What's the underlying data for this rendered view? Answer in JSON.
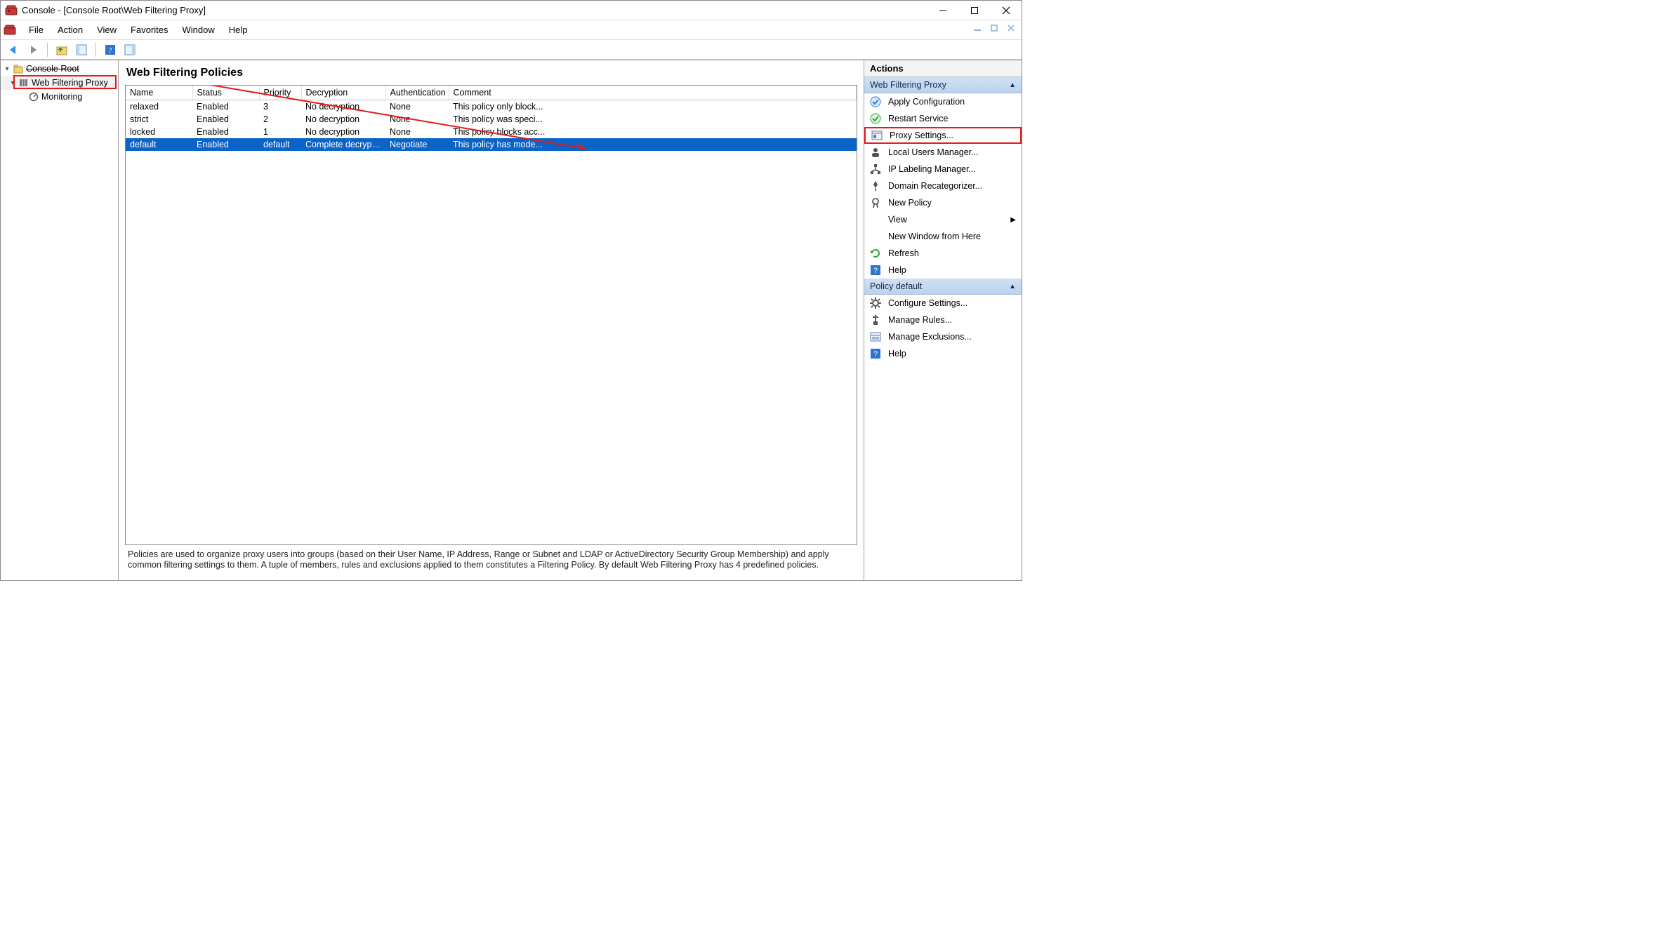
{
  "titlebar": {
    "title": "Console - [Console Root\\Web Filtering Proxy]"
  },
  "menubar": {
    "items": [
      "File",
      "Action",
      "View",
      "Favorites",
      "Window",
      "Help"
    ]
  },
  "tree": {
    "root_label": "Console Root",
    "proxy_label": "Web Filtering Proxy",
    "monitoring_label": "Monitoring"
  },
  "center": {
    "title": "Web Filtering Policies",
    "columns": [
      "Name",
      "Status",
      "Priority",
      "Decryption",
      "Authentication",
      "Comment"
    ],
    "rows": [
      {
        "name": "relaxed",
        "status": "Enabled",
        "priority": "3",
        "decryption": "No decryption",
        "auth": "None",
        "comment": "This policy only block..."
      },
      {
        "name": "strict",
        "status": "Enabled",
        "priority": "2",
        "decryption": "No decryption",
        "auth": "None",
        "comment": "This policy was speci..."
      },
      {
        "name": "locked",
        "status": "Enabled",
        "priority": "1",
        "decryption": "No decryption",
        "auth": "None",
        "comment": "This policy blocks acc..."
      },
      {
        "name": "default",
        "status": "Enabled",
        "priority": "default",
        "decryption": "Complete decryption",
        "auth": "Negotiate",
        "comment": "This policy has mode...",
        "selected": true
      }
    ],
    "description": "Policies are used to organize proxy users into groups (based on their User Name, IP Address, Range or Subnet and LDAP or ActiveDirectory Security Group Membership) and apply common filtering settings to them. A tuple of members, rules and exclusions applied to them constitutes a Filtering Policy. By default Web Filtering Proxy has 4 predefined policies."
  },
  "actions": {
    "header": "Actions",
    "group1_title": "Web Filtering Proxy",
    "group1_items": [
      {
        "id": "apply-config",
        "label": "Apply Configuration",
        "icon": "check-circle-blue"
      },
      {
        "id": "restart-service",
        "label": "Restart Service",
        "icon": "check-circle-green"
      },
      {
        "id": "proxy-settings",
        "label": "Proxy Settings...",
        "icon": "settings-panel",
        "highlight": true
      },
      {
        "id": "local-users",
        "label": "Local Users Manager...",
        "icon": "user"
      },
      {
        "id": "ip-labeling",
        "label": "IP Labeling Manager...",
        "icon": "network"
      },
      {
        "id": "domain-recat",
        "label": "Domain Recategorizer...",
        "icon": "pin"
      },
      {
        "id": "new-policy",
        "label": "New Policy",
        "icon": "ribbon"
      },
      {
        "id": "view",
        "label": "View",
        "icon": "",
        "submenu": true
      },
      {
        "id": "new-window",
        "label": "New Window from Here",
        "icon": ""
      },
      {
        "id": "refresh",
        "label": "Refresh",
        "icon": "refresh"
      },
      {
        "id": "help",
        "label": "Help",
        "icon": "help"
      }
    ],
    "group2_title": "Policy default",
    "group2_items": [
      {
        "id": "configure-settings",
        "label": "Configure Settings...",
        "icon": "gear"
      },
      {
        "id": "manage-rules",
        "label": "Manage Rules...",
        "icon": "rules"
      },
      {
        "id": "manage-exclusions",
        "label": "Manage Exclusions...",
        "icon": "exclusions"
      },
      {
        "id": "help2",
        "label": "Help",
        "icon": "help"
      }
    ]
  }
}
